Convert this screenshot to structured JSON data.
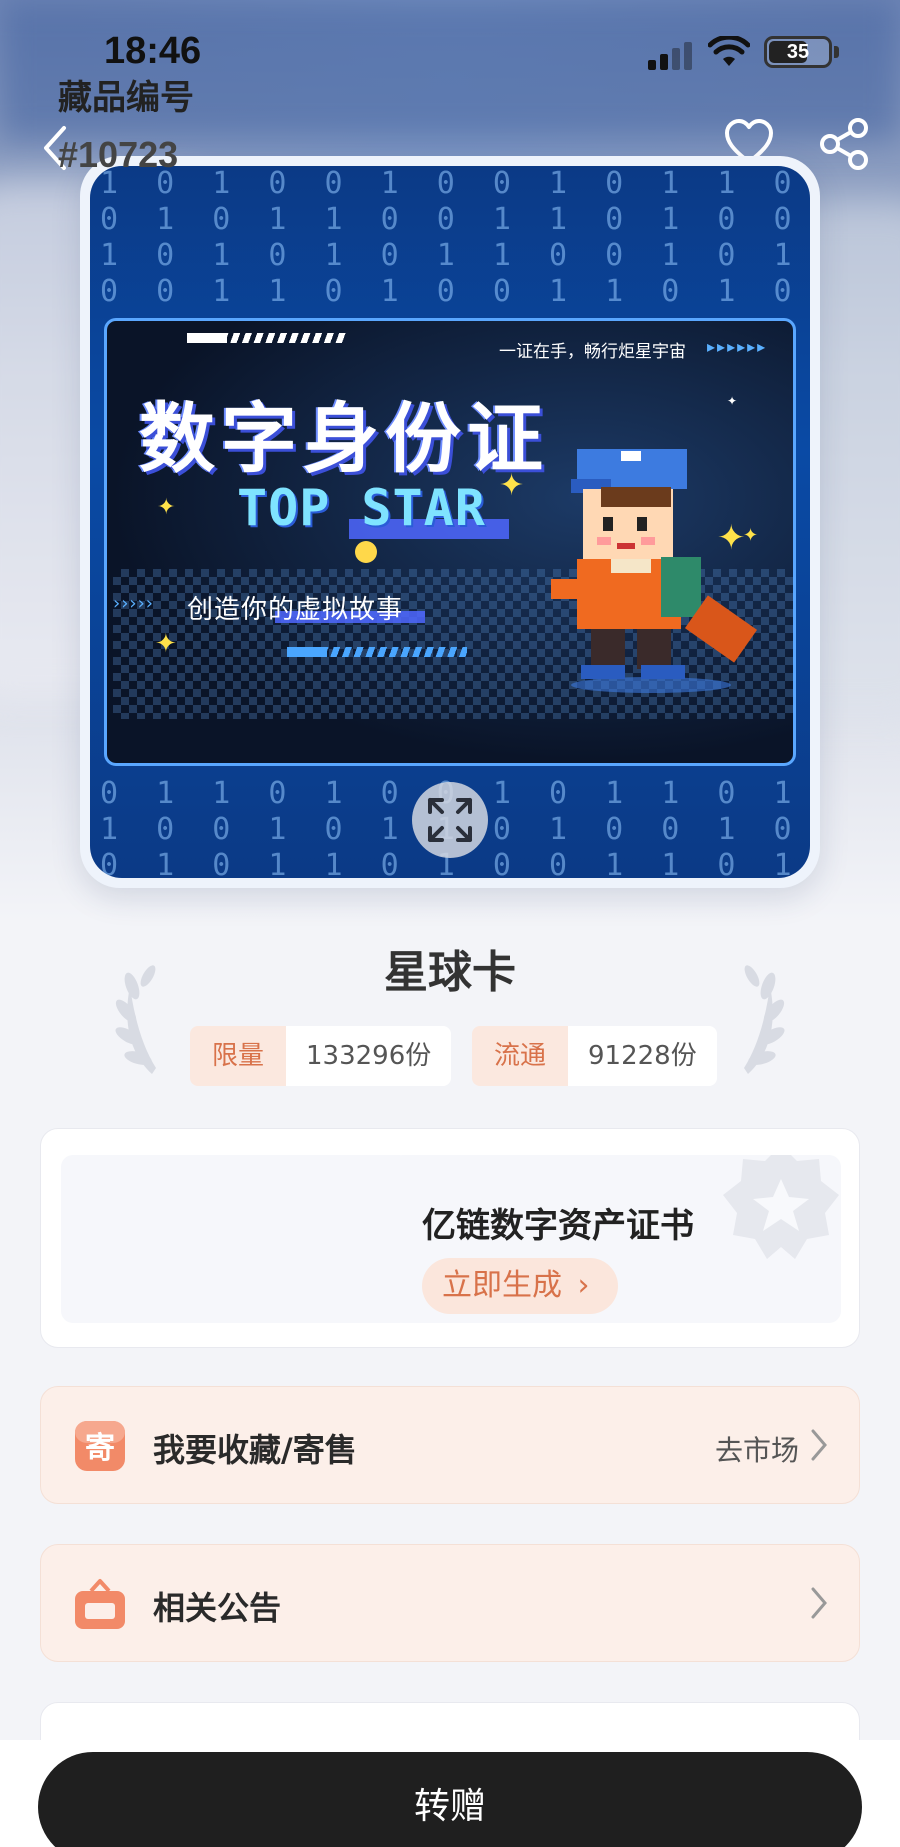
{
  "status_bar": {
    "time": "18:46",
    "battery": "35"
  },
  "artwork": {
    "main_title": "数字身份证",
    "sub_brand": "TOP STAR",
    "slogan": "一证在手，畅行炬星宇宙",
    "tagline": "创造你的虚拟故事"
  },
  "product": {
    "title": "星球卡"
  },
  "supply": {
    "limit_label": "限量",
    "limit_value": "133296份",
    "circulation_label": "流通",
    "circulation_value": "91228份"
  },
  "info": {
    "serial_label": "藏品编号",
    "serial_value": "#10723",
    "cert_label": "亿链数字资产证书",
    "cert_button": "立即生成"
  },
  "rows": {
    "sell_label": "我要收藏/寄售",
    "sell_action": "去市场",
    "notice_label": "相关公告"
  },
  "bottom": {
    "transfer_label": "转赠"
  },
  "colors": {
    "accent": "#d8724a",
    "pill_bg": "#fbe8df",
    "primary_button": "#1f1f1f"
  }
}
